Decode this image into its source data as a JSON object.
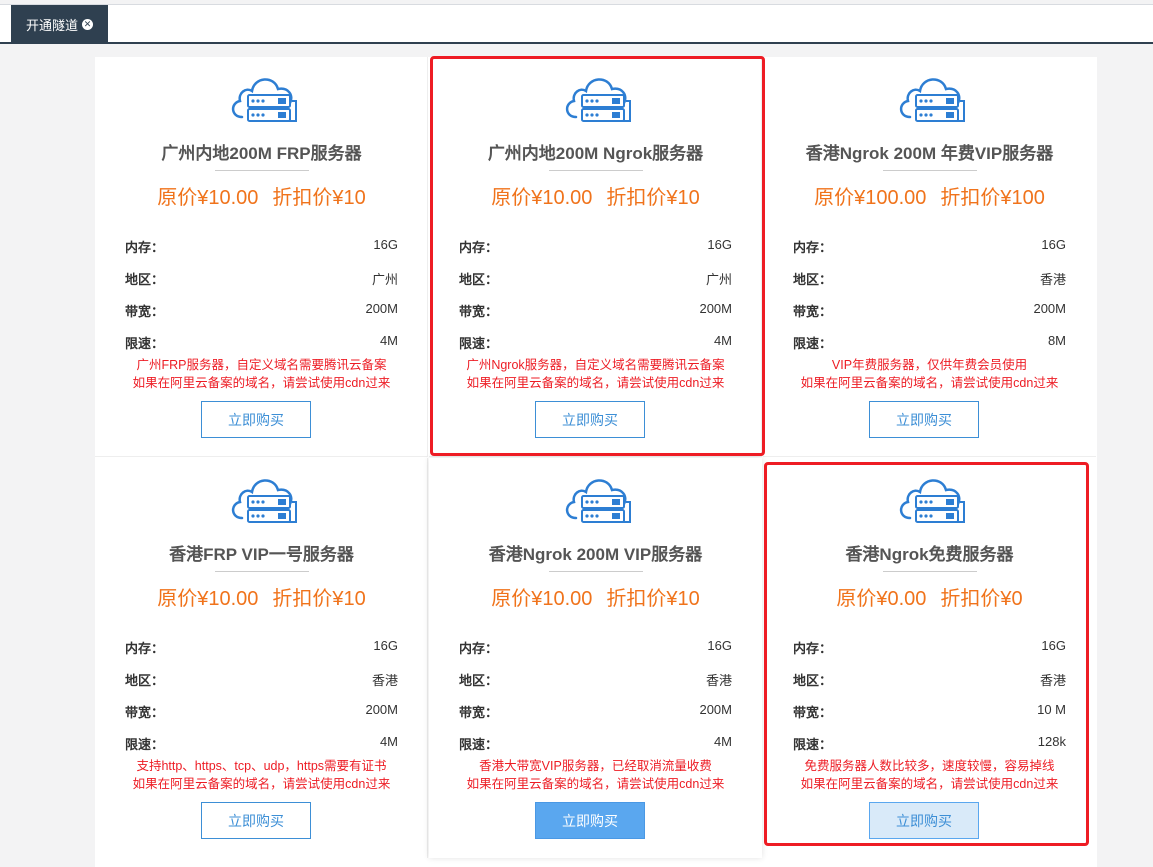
{
  "tab": {
    "label": "开通隧道"
  },
  "spec_labels": {
    "memory": "内存：",
    "region": "地区：",
    "bandwidth": "带宽：",
    "speed_limit": "限速："
  },
  "cards": [
    {
      "title": "广州内地200M FRP服务器",
      "original_price": "原价¥10.00",
      "discount_price": "折扣价¥10",
      "memory": "16G",
      "region": "广州",
      "bandwidth": "200M",
      "speed_limit": "4M",
      "note_line1": "广州FRP服务器，自定义域名需要腾讯云备案",
      "note_line2": "如果在阿里云备案的域名，请尝试使用cdn过来",
      "buy_label": "立即购买"
    },
    {
      "title": "广州内地200M Ngrok服务器",
      "original_price": "原价¥10.00",
      "discount_price": "折扣价¥10",
      "memory": "16G",
      "region": "广州",
      "bandwidth": "200M",
      "speed_limit": "4M",
      "note_line1": "广州Ngrok服务器，自定义域名需要腾讯云备案",
      "note_line2": "如果在阿里云备案的域名，请尝试使用cdn过来",
      "buy_label": "立即购买"
    },
    {
      "title": "香港Ngrok 200M 年费VIP服务器",
      "original_price": "原价¥100.00",
      "discount_price": "折扣价¥100",
      "memory": "16G",
      "region": "香港",
      "bandwidth": "200M",
      "speed_limit": "8M",
      "note_line1": "VIP年费服务器，仅供年费会员使用",
      "note_line2": "如果在阿里云备案的域名，请尝试使用cdn过来",
      "buy_label": "立即购买"
    },
    {
      "title": "香港FRP VIP一号服务器",
      "original_price": "原价¥10.00",
      "discount_price": "折扣价¥10",
      "memory": "16G",
      "region": "香港",
      "bandwidth": "200M",
      "speed_limit": "4M",
      "note_line1": "支持http、https、tcp、udp，https需要有证书",
      "note_line2": "如果在阿里云备案的域名，请尝试使用cdn过来",
      "buy_label": "立即购买"
    },
    {
      "title": "香港Ngrok 200M VIP服务器",
      "original_price": "原价¥10.00",
      "discount_price": "折扣价¥10",
      "memory": "16G",
      "region": "香港",
      "bandwidth": "200M",
      "speed_limit": "4M",
      "note_line1": "香港大带宽VIP服务器，已经取消流量收费",
      "note_line2": "如果在阿里云备案的域名，请尝试使用cdn过来",
      "buy_label": "立即购买"
    },
    {
      "title": "香港Ngrok免费服务器",
      "original_price": "原价¥0.00",
      "discount_price": "折扣价¥0",
      "memory": "16G",
      "region": "香港",
      "bandwidth": "10 M",
      "speed_limit": "128k",
      "note_line1": "免费服务器人数比较多，速度较慢，容易掉线",
      "note_line2": "如果在阿里云备案的域名，请尝试使用cdn过来",
      "buy_label": "立即购买"
    }
  ],
  "colors": {
    "accent_orange": "#f0731b",
    "note_red": "#ed1c24",
    "button_blue": "#3d8fd6",
    "highlight_red": "#ee1c24",
    "tab_dark": "#2f4050"
  },
  "icon": "cloud-server-icon"
}
